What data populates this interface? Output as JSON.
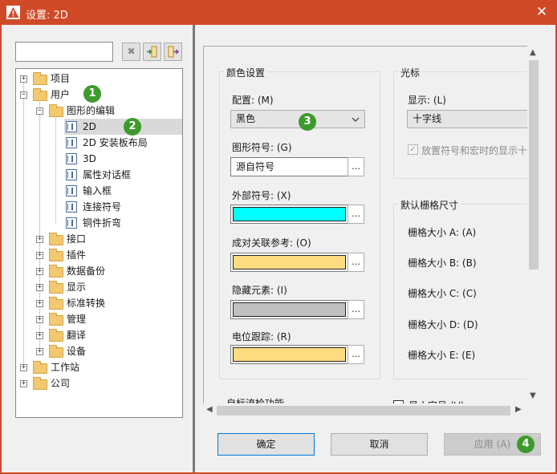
{
  "window": {
    "title": "设置: 2D",
    "close_glyph": "✕",
    "title_color": "#d04a27"
  },
  "toolbar": {
    "clear_glyph": "✖",
    "search_placeholder": ""
  },
  "tree": {
    "items": [
      {
        "label": "项目"
      },
      {
        "label": "用户"
      },
      {
        "label": "图形的编辑"
      },
      {
        "label": "2D"
      },
      {
        "label": "2D 安装板布局"
      },
      {
        "label": "3D"
      },
      {
        "label": "属性对话框"
      },
      {
        "label": "输入框"
      },
      {
        "label": "连接符号"
      },
      {
        "label": "铜件折弯"
      },
      {
        "label": "接口"
      },
      {
        "label": "插件"
      },
      {
        "label": "数据备份"
      },
      {
        "label": "显示"
      },
      {
        "label": "标准转换"
      },
      {
        "label": "管理"
      },
      {
        "label": "翻译"
      },
      {
        "label": "设备"
      },
      {
        "label": "工作站"
      },
      {
        "label": "公司"
      }
    ],
    "selected": "2D"
  },
  "markers": [
    "1",
    "2",
    "3",
    "4"
  ],
  "colors": {
    "group_title": "颜色设置",
    "config_label": "配置: (M)",
    "config_value": "黑色",
    "graphic_symbol_label": "图形符号: (G)",
    "graphic_symbol_value": "源自符号",
    "external_symbol_label": "外部符号: (X)",
    "external_symbol_color": "#00ffff",
    "paired_ref_label": "成对关联参考: (O)",
    "paired_ref_color": "#ffdb80",
    "hidden_label": "隐藏元素: (I)",
    "hidden_color": "#c0c0c0",
    "potential_label": "电位跟踪: (R)",
    "potential_color": "#ffdb80"
  },
  "cursor": {
    "group_title": "光标",
    "display_label": "显示: (L)",
    "display_value": "十字线",
    "place_checkbox_label": "放置符号和宏时的显示十"
  },
  "grid": {
    "group_title": "默认栅格尺寸",
    "items": [
      "栅格大小 A: (A)",
      "栅格大小 B: (B)",
      "栅格大小 C: (C)",
      "栅格大小 D: (D)",
      "栅格大小 E: (E)"
    ]
  },
  "cutoff": {
    "left_text": "自标流检功能",
    "right_text": "显小字号 (V)"
  },
  "buttons": {
    "ok": "确定",
    "cancel": "取消",
    "apply": "应用 (A)"
  }
}
